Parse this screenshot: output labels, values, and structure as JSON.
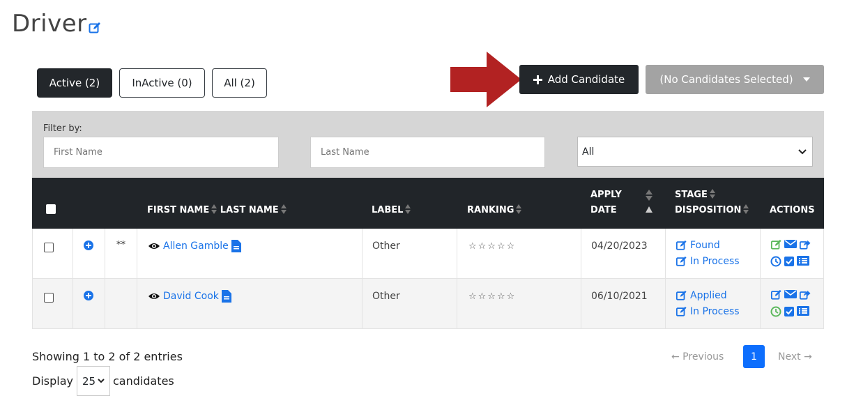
{
  "page": {
    "title": "Driver"
  },
  "tabs": [
    {
      "label": "Active (2)",
      "active": true
    },
    {
      "label": "InActive (0)",
      "active": false
    },
    {
      "label": "All (2)",
      "active": false
    }
  ],
  "toolbar": {
    "add_label": "Add Candidate",
    "bulk_label": "(No Candidates Selected)"
  },
  "filter": {
    "label": "Filter by:",
    "first_name_placeholder": "First Name",
    "last_name_placeholder": "Last Name",
    "status_selected": "All"
  },
  "table": {
    "headers": {
      "first_name": "FIRST NAME",
      "last_name": "LAST NAME",
      "label": "LABEL",
      "ranking": "RANKING",
      "apply": "APPLY",
      "date": "DATE",
      "stage": "STAGE",
      "disposition": "DISPOSITION",
      "actions": "ACTIONS"
    },
    "rows": [
      {
        "flag": "**",
        "name": "Allen Gamble",
        "label": "Other",
        "ranking": "☆☆☆☆☆",
        "rating_value": 0,
        "apply_date": "04/20/2023",
        "stage": "Found",
        "disposition": "In Process"
      },
      {
        "flag": "",
        "name": "David Cook",
        "label": "Other",
        "ranking": "☆☆☆☆☆",
        "rating_value": 0,
        "apply_date": "06/10/2021",
        "stage": "Applied",
        "disposition": "In Process"
      }
    ]
  },
  "footer": {
    "showing": "Showing 1 to 2 of 2 entries",
    "display_prefix": "Display",
    "display_value": "25",
    "display_suffix": "candidates",
    "previous": "← Previous",
    "current_page": "1",
    "next": "Next →"
  },
  "colors": {
    "primary": "#0d6efd",
    "link": "#1a73e8",
    "dark": "#212529",
    "arrow": "#b22222",
    "green": "#5cb85c",
    "disabled": "#a3a3a3"
  }
}
